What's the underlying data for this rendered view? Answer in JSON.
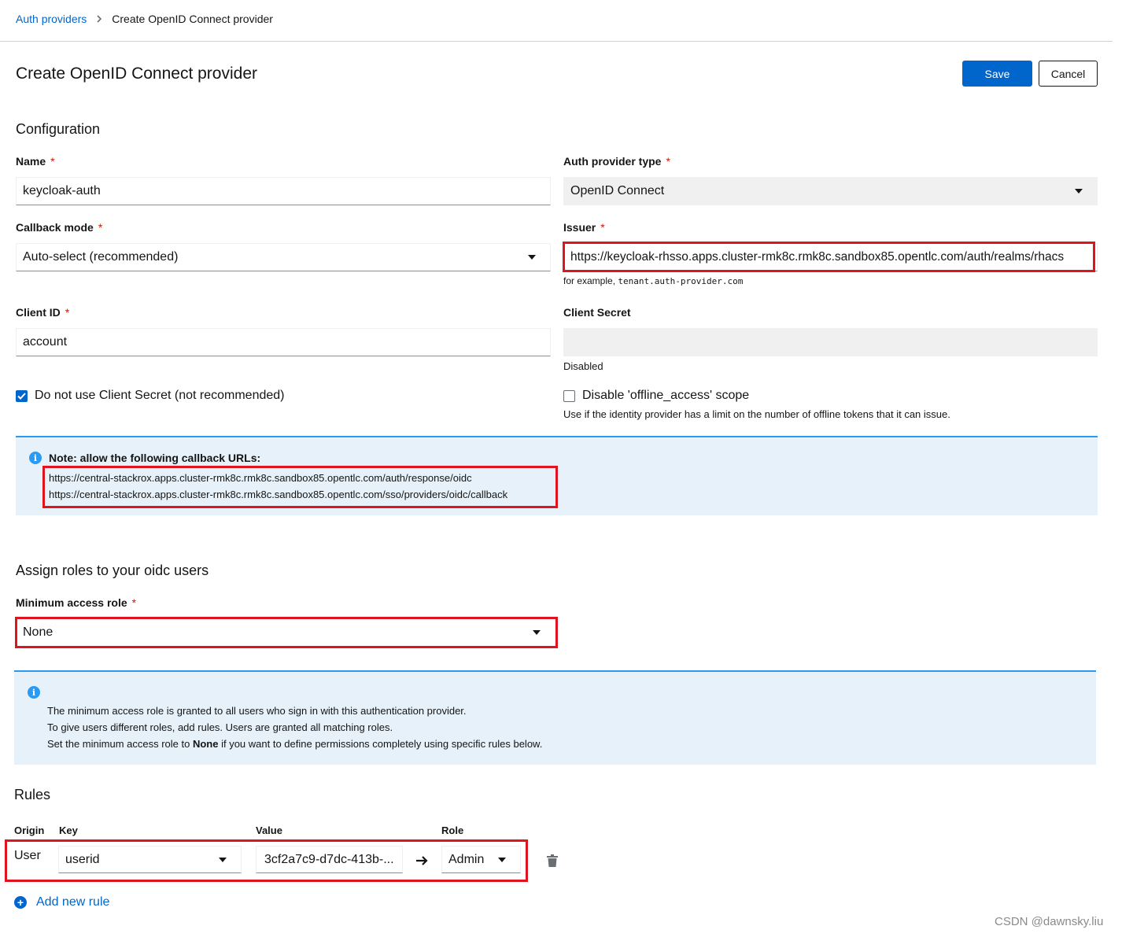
{
  "breadcrumb": {
    "parent": "Auth providers",
    "separator": "›",
    "current": "Create OpenID Connect provider"
  },
  "header": {
    "title": "Create OpenID Connect provider",
    "save_label": "Save",
    "cancel_label": "Cancel"
  },
  "configuration": {
    "heading": "Configuration",
    "name": {
      "label": "Name",
      "required": "*",
      "value": "keycloak-auth"
    },
    "auth_provider_type": {
      "label": "Auth provider type",
      "required": "*",
      "value": "OpenID Connect"
    },
    "callback_mode": {
      "label": "Callback mode",
      "required": "*",
      "value": "Auto-select (recommended)"
    },
    "issuer": {
      "label": "Issuer",
      "required": "*",
      "value": "https://keycloak-rhsso.apps.cluster-rmk8c.rmk8c.sandbox85.opentlc.com/auth/realms/rhacs",
      "helper_prefix": "for example,",
      "helper_example": "tenant.auth-provider.com"
    },
    "client_id": {
      "label": "Client ID",
      "required": "*",
      "value": "account"
    },
    "client_secret": {
      "label": "Client Secret",
      "value": "",
      "helper": "Disabled"
    },
    "no_client_secret": {
      "label": "Do not use Client Secret (not recommended)",
      "checked": true
    },
    "disable_offline": {
      "label": "Disable 'offline_access' scope",
      "checked": false,
      "helper": "Use if the identity provider has a limit on the number of offline tokens that it can issue."
    }
  },
  "callback_note": {
    "title": "Note: allow the following callback URLs:",
    "urls": [
      "https://central-stackrox.apps.cluster-rmk8c.rmk8c.sandbox85.opentlc.com/auth/response/oidc",
      "https://central-stackrox.apps.cluster-rmk8c.rmk8c.sandbox85.opentlc.com/sso/providers/oidc/callback"
    ]
  },
  "roles": {
    "heading": "Assign roles to your oidc users",
    "min_role": {
      "label": "Minimum access role",
      "required": "*",
      "value": "None"
    },
    "info": {
      "line1": "The minimum access role is granted to all users who sign in with this authentication provider.",
      "line2": "To give users different roles, add rules. Users are granted all matching roles.",
      "line3_pre": "Set the minimum access role to ",
      "line3_bold": "None",
      "line3_post": " if you want to define permissions completely using specific rules below."
    }
  },
  "rules": {
    "heading": "Rules",
    "columns": {
      "origin": "Origin",
      "key": "Key",
      "value": "Value",
      "role": "Role"
    },
    "rows": [
      {
        "origin": "User",
        "key": "userid",
        "value": "3cf2a7c9-d7dc-413b-...",
        "role": "Admin"
      }
    ],
    "add_label": "Add new rule"
  },
  "watermark": "CSDN @dawnsky.liu",
  "colors": {
    "primary": "#0066cc",
    "info": "#2b9af3",
    "highlight": "#e0141e"
  }
}
